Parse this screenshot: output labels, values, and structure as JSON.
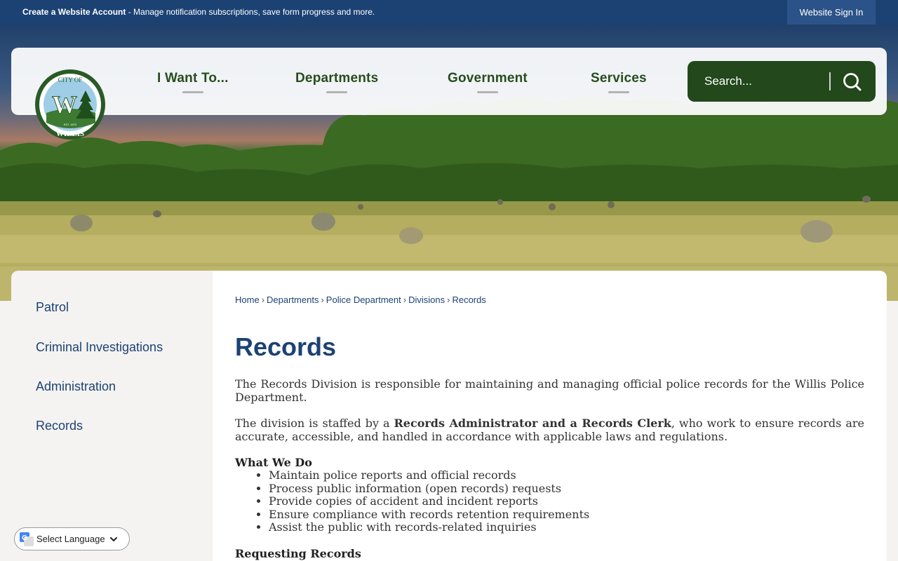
{
  "topbar": {
    "account_strong": "Create a Website Account",
    "account_rest": " - Manage notification subscriptions, save form progress and more.",
    "signin": "Website Sign In"
  },
  "nav": {
    "items": [
      "I Want To...",
      "Departments",
      "Government",
      "Services"
    ],
    "search_placeholder": "Search..."
  },
  "logo": {
    "top_text": "CITY OF",
    "bottom_text": "WILLIS",
    "est": "EST. 1870"
  },
  "sidebar": {
    "items": [
      "Patrol",
      "Criminal Investigations",
      "Administration",
      "Records"
    ]
  },
  "breadcrumb": [
    "Home",
    "Departments",
    "Police Department",
    "Divisions",
    "Records"
  ],
  "page": {
    "title": "Records",
    "p1": "The Records Division is responsible for maintaining and managing official police records for the Willis Police Department.",
    "p2_before": "The division is staffed by a ",
    "p2_bold": "Records Administrator and a Records Clerk",
    "p2_after": ", who work to ensure records are accurate, accessible, and handled in accordance with applicable laws and regulations.",
    "what_heading": "What We Do",
    "what_items": [
      "Maintain police reports and official records",
      "Process public information (open records) requests",
      "Provide copies of accident and incident reports",
      "Ensure compliance with records retention requirements",
      "Assist the public with records-related inquiries"
    ],
    "requesting_heading": "Requesting Records"
  },
  "language": {
    "label": "Select Language"
  },
  "colors": {
    "brand_blue": "#1c4274",
    "brand_green": "#22481b"
  }
}
